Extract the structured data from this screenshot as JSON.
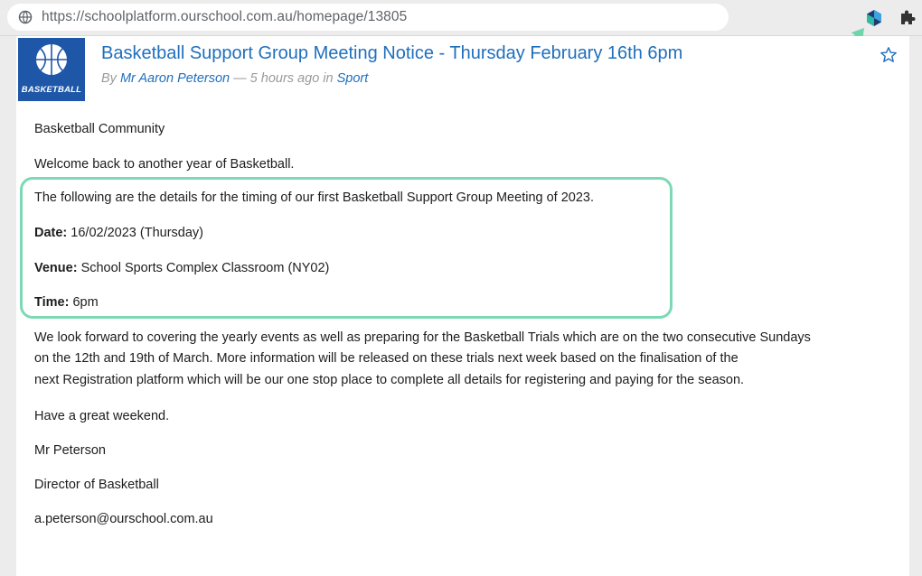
{
  "browser": {
    "url": "https://schoolplatform.ourschool.com.au/homepage/13805"
  },
  "post": {
    "logo_text": "BASKETBALL",
    "title": "Basketball Support Group Meeting Notice - Thursday February 16th 6pm",
    "by_prefix": "By",
    "author": "Mr Aaron Peterson",
    "time_sep": "— 5 hours ago in",
    "category": "Sport"
  },
  "body": {
    "greeting": "Basketball Community",
    "welcome": "Welcome back to another year of Basketball.",
    "details_intro": "The following are the details for the timing of our first Basketball Support Group Meeting of 2023.",
    "date_label": "Date:",
    "date_value": " 16/02/2023 (Thursday)",
    "venue_label": "Venue:",
    "venue_value": " School Sports Complex Classroom (NY02)",
    "time_label": "Time:",
    "time_value": " 6pm",
    "look_forward_1": "We look forward to covering the yearly events as well as preparing for the Basketball Trials which are on the two consecutive Sundays",
    "look_forward_2": "on the 12th and 19th of March. More information will be released on these trials next week based on the finalisation of the",
    "look_forward_3": "next Registration platform which will be our one stop place to complete all details for registering and paying for the season.",
    "weekend": "Have a great weekend.",
    "signoff_name": "Mr Peterson",
    "signoff_role": "Director of Basketball",
    "signoff_email": "a.peterson@ourschool.com.au"
  },
  "colors": {
    "link": "#1f6fbd",
    "logo_bg": "#1e57a7",
    "highlight": "#7dd9b5"
  },
  "icons": [
    "globe-icon",
    "extension-icon",
    "puzzle-icon",
    "star-icon",
    "basketball-icon",
    "arrow-icon"
  ]
}
